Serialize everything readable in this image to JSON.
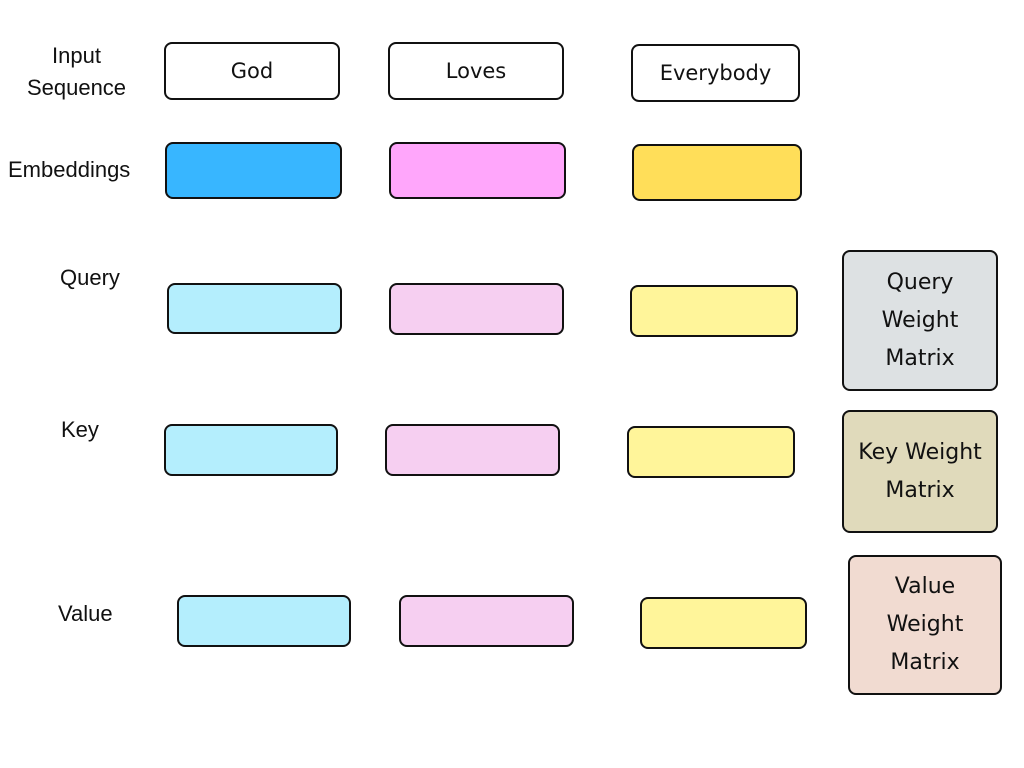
{
  "labels": {
    "input": "Input Sequence",
    "embeddings": "Embeddings",
    "query": "Query",
    "key": "Key",
    "value": "Value"
  },
  "tokens": [
    "God",
    "Loves",
    "Everybody"
  ],
  "colors": {
    "embeddings": [
      "#38b6ff",
      "#ffa6fb",
      "#ffde59"
    ],
    "projections": [
      "#b4eefd",
      "#f6cff1",
      "#fff59a"
    ],
    "query_matrix": "#dde1e3",
    "key_matrix": "#e0dabb",
    "value_matrix": "#f1dbd1"
  },
  "matrices": {
    "query": "Query Weight Matrix",
    "key": "Key Weight Matrix",
    "value": "Value Weight Matrix"
  }
}
